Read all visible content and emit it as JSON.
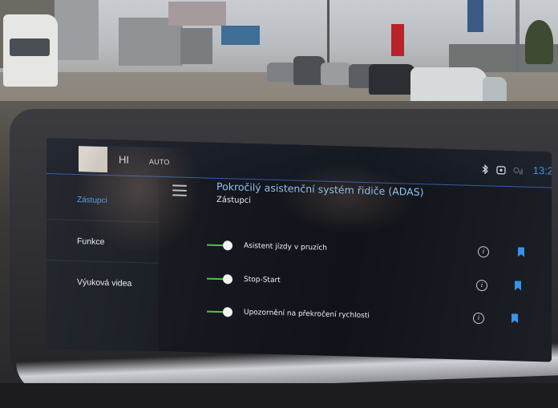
{
  "status_bar": {
    "greeting": "HI",
    "climate_mode": "AUTO",
    "time": "13:2",
    "icons": [
      "bluetooth-icon",
      "phone-icon",
      "signal-icon"
    ]
  },
  "sidebar": {
    "items": [
      {
        "label": "Zástupci",
        "active": true
      },
      {
        "label": "Funkce",
        "active": false
      },
      {
        "label": "Výuková videa",
        "active": false
      }
    ]
  },
  "content": {
    "title": "Pokročilý asistenční systém řidiče (ADAS)",
    "subtitle": "Zástupci",
    "rows": [
      {
        "label": "Asistent jízdy v pruzích",
        "enabled": true
      },
      {
        "label": "Stop-Start",
        "enabled": true
      },
      {
        "label": "Upozornění na překročení rychlosti",
        "enabled": true
      }
    ]
  },
  "colors": {
    "accent": "#3c8fe2",
    "toggle_on": "#4fc04a",
    "screen_bg": "#101319"
  }
}
